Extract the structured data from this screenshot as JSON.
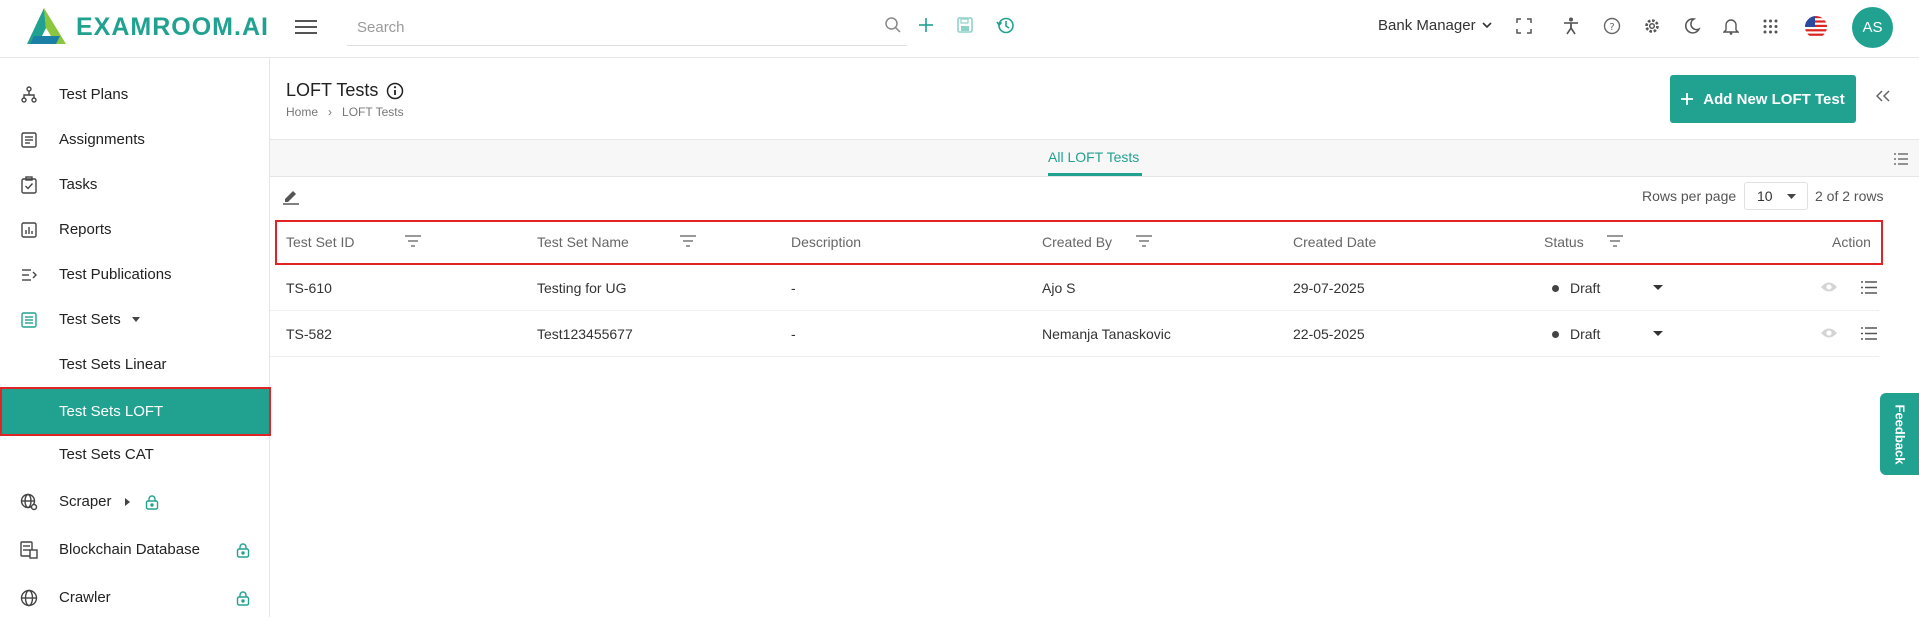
{
  "brand": {
    "name": "EXAMROOM.AI",
    "color": "#21a291"
  },
  "search": {
    "placeholder": "Search"
  },
  "header": {
    "role": "Bank Manager",
    "avatar_initials": "AS"
  },
  "sidebar": {
    "items": [
      {
        "label": "Test Plans",
        "icon": "hierarchy-icon"
      },
      {
        "label": "Assignments",
        "icon": "assignment-icon"
      },
      {
        "label": "Tasks",
        "icon": "clipboard-check-icon"
      },
      {
        "label": "Reports",
        "icon": "bar-chart-icon"
      },
      {
        "label": "Test Publications",
        "icon": "publish-list-icon"
      },
      {
        "label": "Test Sets",
        "icon": "list-box-icon"
      },
      {
        "label": "Test Sets Linear"
      },
      {
        "label": "Test Sets LOFT"
      },
      {
        "label": "Test Sets CAT"
      },
      {
        "label": "Scraper",
        "icon": "globe-settings-icon"
      },
      {
        "label": "Blockchain Database",
        "icon": "database-icon"
      },
      {
        "label": "Crawler",
        "icon": "globe-icon"
      }
    ]
  },
  "page": {
    "title": "LOFT Tests",
    "breadcrumb": [
      "Home",
      "LOFT Tests"
    ],
    "add_button": "Add New LOFT Test",
    "tab": "All LOFT Tests"
  },
  "table": {
    "rows_per_page_label": "Rows per page",
    "rows_per_page": "10",
    "rows_count": "2 of 2 rows",
    "columns": [
      "Test Set ID",
      "Test Set Name",
      "Description",
      "Created By",
      "Created Date",
      "Status",
      "Action"
    ],
    "rows": [
      {
        "id": "TS-610",
        "name": "Testing for UG",
        "description": "-",
        "created_by": "Ajo S",
        "created_date": "29-07-2025",
        "status": "Draft"
      },
      {
        "id": "TS-582",
        "name": "Test123455677",
        "description": "-",
        "created_by": "Nemanja Tanaskovic",
        "created_date": "22-05-2025",
        "status": "Draft"
      }
    ]
  },
  "feedback": {
    "label": "Feedback"
  }
}
